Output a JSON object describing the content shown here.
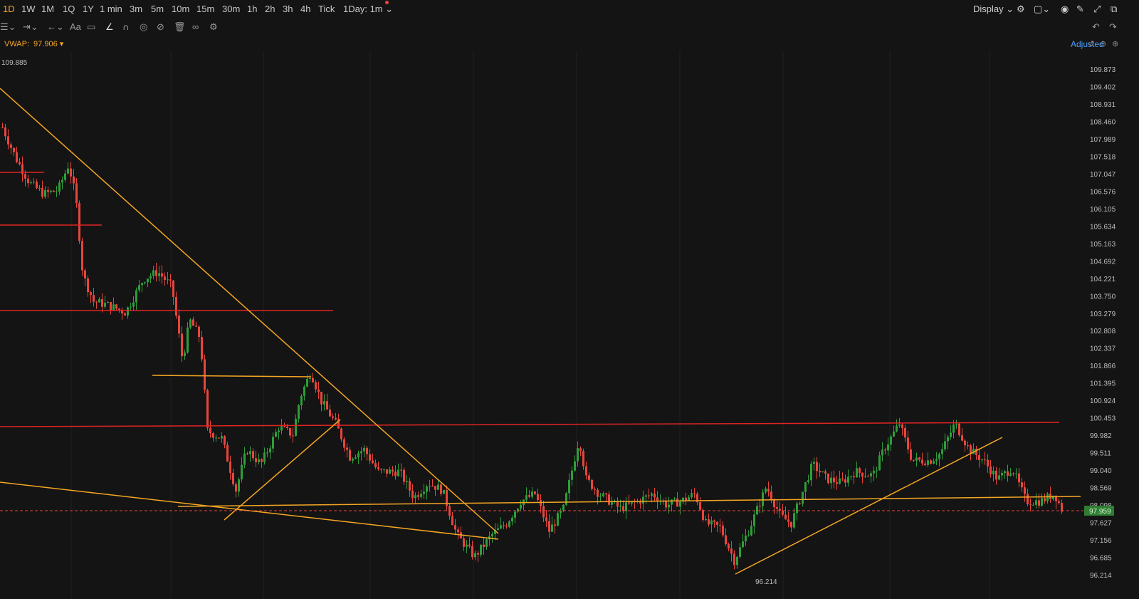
{
  "timeframes": [
    {
      "label": "1D",
      "active": true
    },
    {
      "label": "1W"
    },
    {
      "label": "1M"
    },
    {
      "label": "1Q"
    },
    {
      "label": "1Y"
    },
    {
      "label": "1 min"
    },
    {
      "label": "3m"
    },
    {
      "label": "5m"
    },
    {
      "label": "10m"
    },
    {
      "label": "15m"
    },
    {
      "label": "30m"
    },
    {
      "label": "1h"
    },
    {
      "label": "2h"
    },
    {
      "label": "3h"
    },
    {
      "label": "4h"
    },
    {
      "label": "Tick"
    },
    {
      "label": "1Day: 1m"
    }
  ],
  "toolbar": {
    "display_label": "Display",
    "text_tool": "Aa",
    "adjusted_label": "Adjusted"
  },
  "indicator": {
    "name": "VWAP:",
    "value": "97.906"
  },
  "chart_data": {
    "type": "candlestick",
    "price_axis": [
      "109.873",
      "109.402",
      "108.931",
      "108.460",
      "107.989",
      "107.518",
      "107.047",
      "106.576",
      "106.105",
      "105.634",
      "105.163",
      "104.692",
      "104.221",
      "103.750",
      "103.279",
      "102.808",
      "102.337",
      "101.866",
      "101.395",
      "100.924",
      "100.453",
      "99.982",
      "99.511",
      "99.040",
      "98.569",
      "98.098",
      "97.627",
      "97.156",
      "96.685",
      "96.214"
    ],
    "high_label": "109.885",
    "low_label": "96.214",
    "current_price": "97.959",
    "ylim": [
      96.0,
      110.2
    ],
    "colors": {
      "up": "#2e9e3a",
      "down": "#e8453c",
      "trendline": "#f5a623",
      "resistance": "#e02424"
    }
  }
}
